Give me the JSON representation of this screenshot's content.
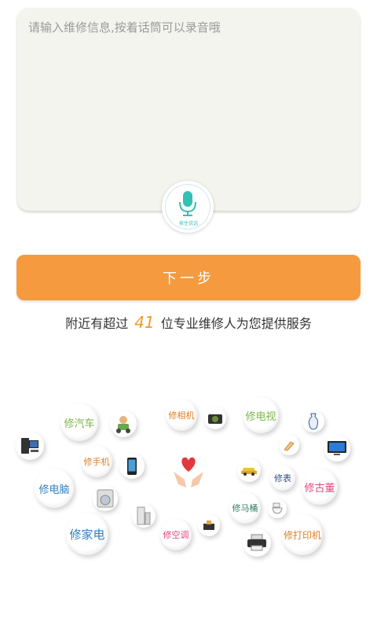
{
  "input": {
    "placeholder": "请输入维修信息,按着话筒可以录音哦"
  },
  "mic": {
    "label": "按住说话"
  },
  "next_button": {
    "label": "下一步"
  },
  "info": {
    "prefix": "附近有超过",
    "count": "41",
    "suffix": "位专业维修人为您提供服务"
  },
  "services": {
    "car": "修汽车",
    "phone": "修手机",
    "computer": "修电脑",
    "appliance": "修家电",
    "camera": "修相机",
    "tv": "修电视",
    "watch": "修表",
    "antique": "修古董",
    "toilet": "修马桶",
    "ac": "修空调",
    "printer": "修打印机"
  },
  "colors": {
    "accent_orange": "#f59a3f",
    "teal": "#36bfb5",
    "green": "#7ab648",
    "blue": "#2f7fbf",
    "pink": "#e0457a",
    "orange": "#e07d22"
  }
}
